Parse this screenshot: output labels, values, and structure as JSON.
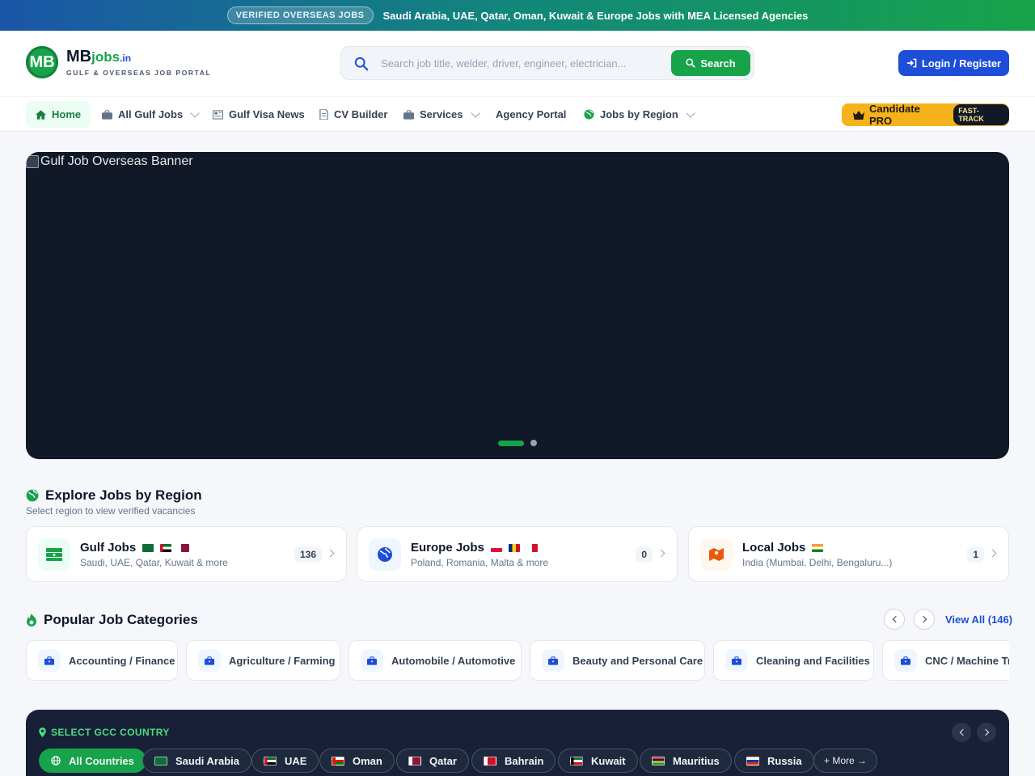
{
  "topbar": {
    "badge": "VERIFIED OVERSEAS JOBS",
    "message": "Saudi Arabia, UAE, Qatar, Oman, Kuwait & Europe Jobs with MEA Licensed Agencies"
  },
  "brand": {
    "initials": "MB",
    "name_main": "MB",
    "name_accent": "jobs",
    "name_tld": ".in",
    "tagline": "GULF & OVERSEAS JOB PORTAL"
  },
  "search": {
    "placeholder": "Search job title, welder, driver, engineer, electrician...",
    "button": "Search"
  },
  "login": {
    "label": "Login / Register"
  },
  "nav": {
    "home": "Home",
    "all_gulf_jobs": "All Gulf Jobs",
    "gulf_visa_news": "Gulf Visa News",
    "cv_builder": "CV Builder",
    "services": "Services",
    "agency_portal": "Agency Portal",
    "jobs_by_region": "Jobs by Region",
    "pro_label": "Candidate PRO",
    "pro_badge": "FAST-TRACK"
  },
  "hero": {
    "alt_text": "Gulf Job Overseas Banner",
    "slides": 2,
    "active_slide": 1
  },
  "regions": {
    "title": "Explore Jobs by Region",
    "subtitle": "Select region to view verified vacancies",
    "items": [
      {
        "title": "Gulf Jobs",
        "subtitle": "Saudi, UAE, Qatar, Kuwait & more",
        "count": "136",
        "color": "#16a34a",
        "bg": "#ecfdf3"
      },
      {
        "title": "Europe Jobs",
        "subtitle": "Poland, Romania, Malta & more",
        "count": "0",
        "color": "#1d4ed8",
        "bg": "#eff6ff"
      },
      {
        "title": "Local Jobs",
        "subtitle": "India (Mumbai, Delhi, Bengaluru...)",
        "count": "1",
        "color": "#ea580c",
        "bg": "#fff7ed"
      }
    ]
  },
  "categories": {
    "title": "Popular Job Categories",
    "view_all": "View All (146)",
    "items": [
      "Accounting / Finance",
      "Agriculture / Farming",
      "Automobile / Automotive",
      "Beauty and Personal Care",
      "Cleaning and Facilities",
      "CNC / Machine Training"
    ]
  },
  "gcc": {
    "label": "SELECT GCC COUNTRY",
    "all": "All Countries",
    "countries": [
      "Saudi Arabia",
      "UAE",
      "Oman",
      "Qatar",
      "Bahrain",
      "Kuwait",
      "Mauritius",
      "Russia"
    ],
    "more": "+ More →"
  },
  "colors": {
    "primary": "#16a34a",
    "blue": "#1d4ed8",
    "pro": "#f5b21b",
    "dark": "#172036"
  }
}
